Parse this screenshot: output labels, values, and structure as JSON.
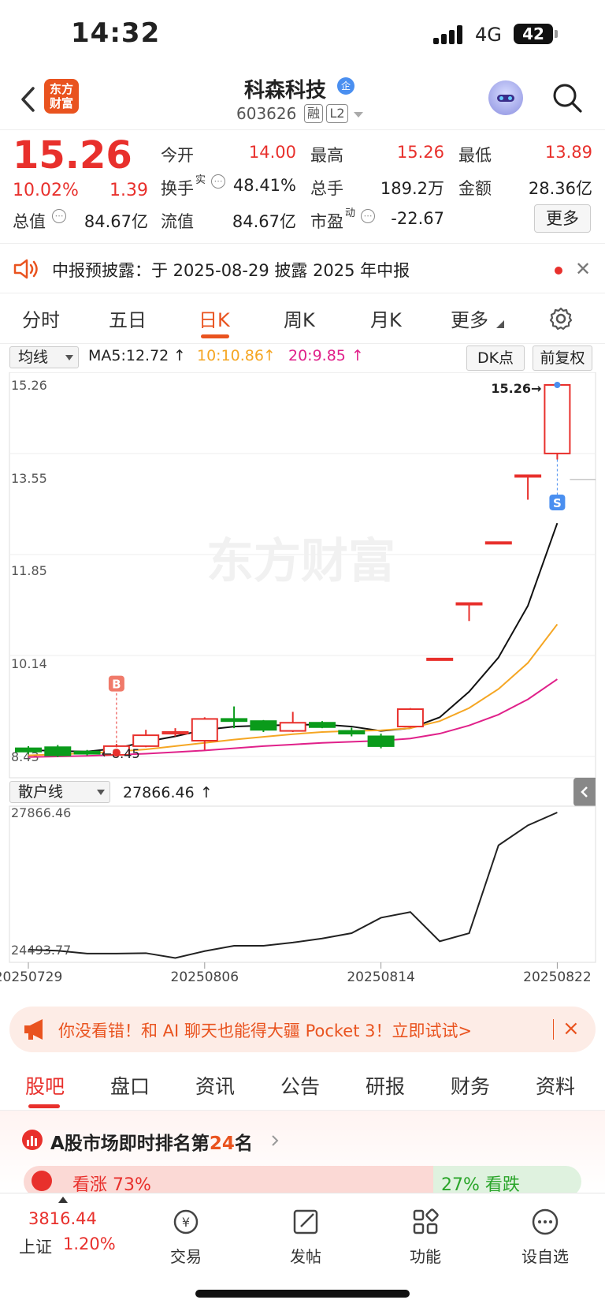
{
  "status_bar": {
    "time": "14:32",
    "network": "4G",
    "battery": "42"
  },
  "header": {
    "logo_text": "东方财富",
    "stock_name": "科森科技",
    "enterprise_badge": "企",
    "stock_code": "603626",
    "tags": [
      "融",
      "L2"
    ]
  },
  "quote": {
    "price": "15.26",
    "change_pct": "10.02%",
    "change": "1.39",
    "fields": [
      {
        "label": "今开",
        "value": "14.00",
        "color": "red"
      },
      {
        "label": "最高",
        "value": "15.26",
        "color": "red"
      },
      {
        "label": "最低",
        "value": "13.89",
        "color": "red"
      },
      {
        "label": "换手",
        "sup": "实",
        "value": "48.41%",
        "color": "dark"
      },
      {
        "label": "总手",
        "value": "189.2万",
        "color": "dark"
      },
      {
        "label": "金额",
        "value": "28.36亿",
        "color": "dark"
      },
      {
        "label": "总值",
        "value": "84.67亿",
        "color": "dark"
      },
      {
        "label": "流值",
        "value": "84.67亿",
        "color": "dark"
      },
      {
        "label": "市盈",
        "sup": "动",
        "value": "-22.67",
        "color": "dark"
      }
    ],
    "more_label": "更多"
  },
  "notice": {
    "text": "中报预披露：于 2025-08-29 披露 2025 年中报"
  },
  "chart_tabs": [
    "分时",
    "五日",
    "日K",
    "周K",
    "月K",
    "更多"
  ],
  "chart_tabs_active": "日K",
  "ma_bar": {
    "selector": "均线",
    "ma5": "MA5:12.72",
    "ma10": "10:10.86",
    "ma20": "20:9.85",
    "dk_label": "DK点",
    "adjust_label": "前复权"
  },
  "retail_bar": {
    "selector": "散户线",
    "value": "27866.46"
  },
  "chart_data": [
    {
      "type": "candlestick",
      "y_axis_labels": [
        "15.26",
        "13.55",
        "11.85",
        "10.14",
        "8.43"
      ],
      "ylim": [
        8.43,
        15.26
      ],
      "annotations": {
        "high_marker": "15.26→",
        "low_marker": "←8.45",
        "buy_marker": "B",
        "sell_marker": "S"
      },
      "watermark": "东方财富",
      "candles": [
        {
          "o": 8.58,
          "c": 8.52,
          "h": 8.62,
          "l": 8.48
        },
        {
          "o": 8.6,
          "c": 8.45,
          "h": 8.64,
          "l": 8.42
        },
        {
          "o": 8.52,
          "c": 8.48,
          "h": 8.55,
          "l": 8.45
        },
        {
          "o": 8.46,
          "c": 8.62,
          "h": 8.66,
          "l": 8.45
        },
        {
          "o": 8.62,
          "c": 8.82,
          "h": 8.92,
          "l": 8.6
        },
        {
          "o": 8.85,
          "c": 8.88,
          "h": 8.95,
          "l": 8.8
        },
        {
          "o": 8.72,
          "c": 9.12,
          "h": 9.15,
          "l": 8.55
        },
        {
          "o": 9.12,
          "c": 9.08,
          "h": 9.35,
          "l": 8.95
        },
        {
          "o": 9.08,
          "c": 8.92,
          "h": 9.1,
          "l": 8.88
        },
        {
          "o": 8.9,
          "c": 9.05,
          "h": 9.25,
          "l": 8.88
        },
        {
          "o": 9.05,
          "c": 8.97,
          "h": 9.08,
          "l": 8.95
        },
        {
          "o": 8.9,
          "c": 8.85,
          "h": 8.96,
          "l": 8.8
        },
        {
          "o": 8.8,
          "c": 8.62,
          "h": 8.85,
          "l": 8.58
        },
        {
          "o": 8.98,
          "c": 9.3,
          "h": 9.32,
          "l": 8.96
        },
        {
          "o": 10.23,
          "c": 10.23,
          "h": 10.23,
          "l": 10.23
        },
        {
          "o": 11.25,
          "c": 11.25,
          "h": 11.25,
          "l": 10.92
        },
        {
          "o": 12.37,
          "c": 12.37,
          "h": 12.37,
          "l": 12.37
        },
        {
          "o": 13.6,
          "c": 13.6,
          "h": 13.6,
          "l": 13.15
        },
        {
          "o": 14.0,
          "c": 15.26,
          "h": 15.26,
          "l": 13.89
        }
      ],
      "ma5": [
        8.55,
        8.53,
        8.52,
        8.58,
        8.7,
        8.8,
        8.92,
        8.98,
        9.0,
        9.01,
        9.02,
        8.98,
        8.9,
        8.95,
        9.15,
        9.62,
        10.25,
        11.2,
        12.72
      ],
      "ma10": [
        8.45,
        8.47,
        8.49,
        8.52,
        8.56,
        8.62,
        8.68,
        8.74,
        8.79,
        8.84,
        8.88,
        8.9,
        8.91,
        8.95,
        9.08,
        9.32,
        9.67,
        10.15,
        10.86
      ],
      "ma20": [
        8.42,
        8.43,
        8.44,
        8.46,
        8.48,
        8.51,
        8.54,
        8.58,
        8.62,
        8.65,
        8.68,
        8.7,
        8.72,
        8.76,
        8.85,
        9.0,
        9.2,
        9.48,
        9.85
      ]
    },
    {
      "type": "line",
      "y_axis_labels": [
        "27866.46",
        "24493.77"
      ],
      "ylim": [
        24300,
        27866.46
      ],
      "x_tick_labels": [
        "20250729",
        "20250806",
        "20250814",
        "20250822"
      ],
      "x_tick_index": [
        0,
        6,
        12,
        18
      ],
      "values": [
        24493.77,
        24470,
        24400,
        24400,
        24410,
        24290,
        24460,
        24590,
        24590,
        24670,
        24770,
        24900,
        25280,
        25420,
        24700,
        24900,
        27060,
        27550,
        27866.46
      ]
    }
  ],
  "ad": {
    "text": "你没看错！和 AI 聊天也能得大疆 Pocket 3！立即试试>",
    "close": "×"
  },
  "content_tabs": [
    "股吧",
    "盘口",
    "资讯",
    "公告",
    "研报",
    "财务",
    "资料"
  ],
  "content_tabs_active": "股吧",
  "ranking": {
    "prefix": "A股市场即时排名第",
    "rank": "24",
    "suffix": "名",
    "up_label": "看涨 73%",
    "down_label": "27% 看跌"
  },
  "bottom_nav": {
    "index_value": "3816.44",
    "index_name": "上证",
    "index_change": "1.20%",
    "items": [
      "交易",
      "发帖",
      "功能",
      "设自选"
    ]
  }
}
